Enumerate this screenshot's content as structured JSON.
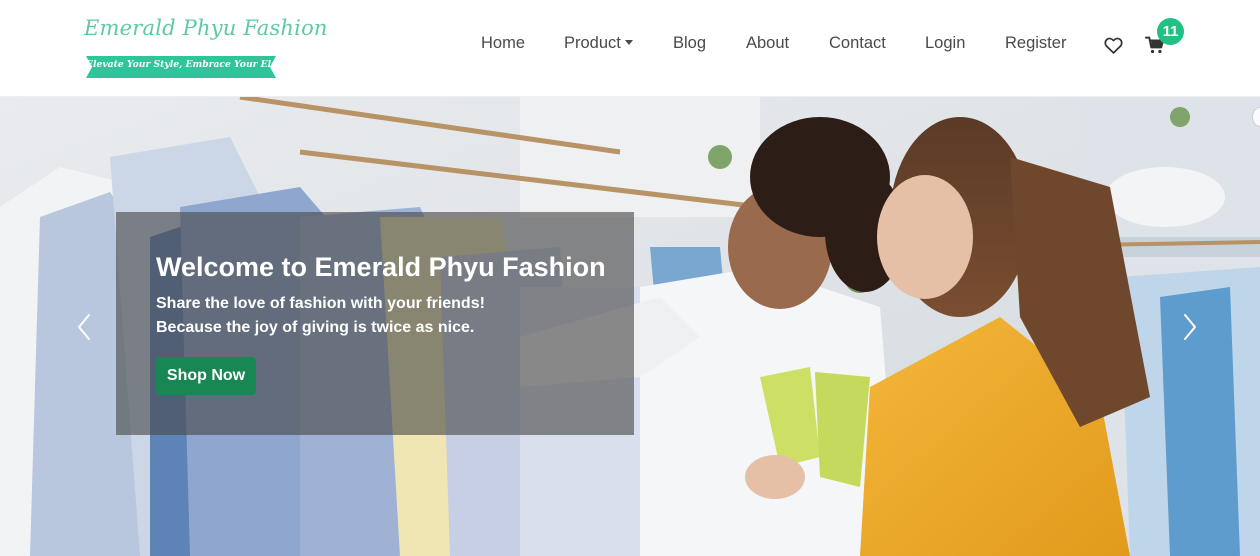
{
  "brand": {
    "name": "Emerald Phyu Fashion",
    "tagline": "Elevate Your Style, Embrace Your Elegance",
    "color": "#5fc9a3",
    "ribbon_color": "#2ec59a"
  },
  "nav": {
    "items": [
      {
        "label": "Home"
      },
      {
        "label": "Product"
      },
      {
        "label": "Blog"
      },
      {
        "label": "About"
      },
      {
        "label": "Contact"
      },
      {
        "label": "Login"
      },
      {
        "label": "Register"
      }
    ],
    "wishlist_icon": "heart-icon",
    "cart_icon": "cart-icon",
    "cart_count": "11",
    "badge_color": "#23c083"
  },
  "hero": {
    "title": "Welcome to Emerald Phyu Fashion",
    "line1": "Share the love of fashion with your friends!",
    "line2": "Because the joy of giving is twice as nice.",
    "cta": "Shop Now",
    "cta_color": "#198754",
    "prev_icon": "chevron-left-icon",
    "next_icon": "chevron-right-icon"
  }
}
